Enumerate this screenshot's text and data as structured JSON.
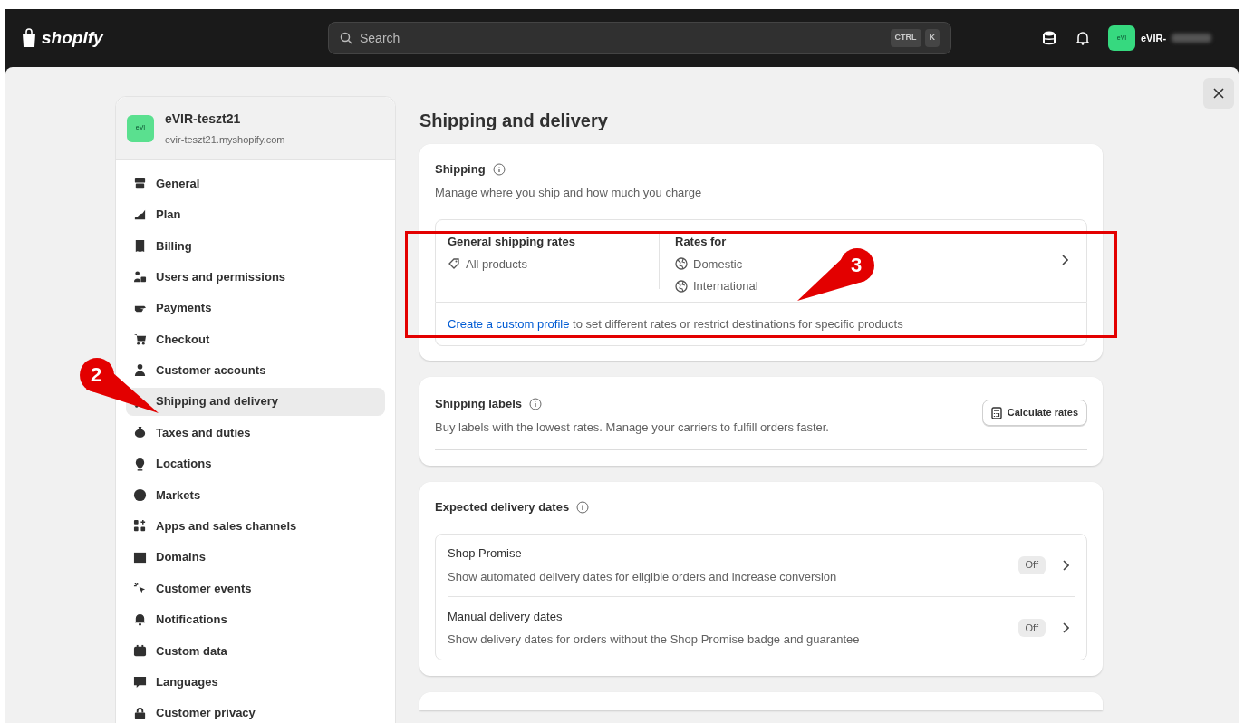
{
  "topbar": {
    "logo": "shopify",
    "search": {
      "placeholder": "Search",
      "shortcut": [
        "CTRL",
        "K"
      ]
    },
    "user": {
      "avatar": "eVI",
      "name": "eVIR-"
    }
  },
  "store": {
    "avatar": "eVI",
    "name": "eVIR-teszt21",
    "domain": "evir-teszt21.myshopify.com"
  },
  "sidebar": {
    "items": [
      {
        "label": "General",
        "selected": false
      },
      {
        "label": "Plan",
        "selected": false
      },
      {
        "label": "Billing",
        "selected": false
      },
      {
        "label": "Users and permissions",
        "selected": false
      },
      {
        "label": "Payments",
        "selected": false
      },
      {
        "label": "Checkout",
        "selected": false
      },
      {
        "label": "Customer accounts",
        "selected": false
      },
      {
        "label": "Shipping and delivery",
        "selected": true
      },
      {
        "label": "Taxes and duties",
        "selected": false
      },
      {
        "label": "Locations",
        "selected": false
      },
      {
        "label": "Markets",
        "selected": false
      },
      {
        "label": "Apps and sales channels",
        "selected": false
      },
      {
        "label": "Domains",
        "selected": false
      },
      {
        "label": "Customer events",
        "selected": false
      },
      {
        "label": "Notifications",
        "selected": false
      },
      {
        "label": "Custom data",
        "selected": false
      },
      {
        "label": "Languages",
        "selected": false
      },
      {
        "label": "Customer privacy",
        "selected": false
      }
    ]
  },
  "page_title": "Shipping and delivery",
  "shipping": {
    "title": "Shipping",
    "description": "Manage where you ship and how much you charge",
    "profile": {
      "title": "General shipping rates",
      "products": "All products",
      "rates_label": "Rates for",
      "zones": [
        "Domestic",
        "International"
      ]
    },
    "custom_note": {
      "link": "Create a custom profile",
      "text": "to set different rates or restrict destinations for specific products"
    }
  },
  "shipping_labels": {
    "title": "Shipping labels",
    "description": "Buy labels with the lowest rates. Manage your carriers to fulfill orders faster.",
    "button": "Calculate rates"
  },
  "delivery_dates": {
    "title": "Expected delivery dates",
    "rows": [
      {
        "title": "Shop Promise",
        "description": "Show automated delivery dates for eligible orders and increase conversion",
        "status": "Off"
      },
      {
        "title": "Manual delivery dates",
        "description": "Show delivery dates for orders without the Shop Promise badge and guarantee",
        "status": "Off"
      }
    ]
  },
  "callouts": [
    {
      "number": "2"
    },
    {
      "number": "3"
    }
  ]
}
